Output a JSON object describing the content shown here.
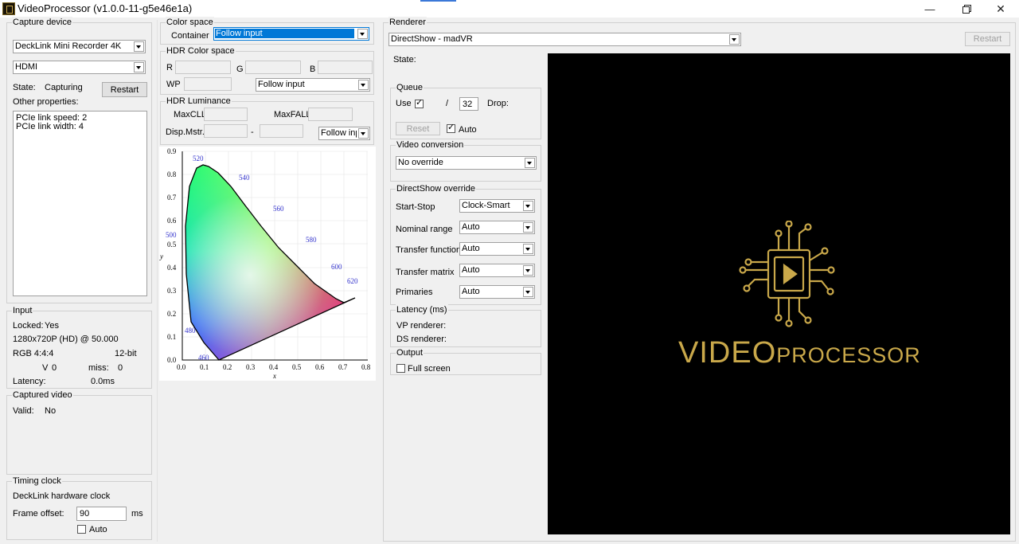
{
  "window": {
    "title": "VideoProcessor (v1.0.0-11-g5e46e1a)"
  },
  "capture_device": {
    "title": "Capture device",
    "device": "DeckLink Mini Recorder 4K",
    "input": "HDMI",
    "state_label": "State:",
    "state_value": "Capturing",
    "restart_label": "Restart",
    "other_properties_label": "Other properties:",
    "properties": [
      "PCIe link speed: 2",
      "PCIe link width: 4"
    ]
  },
  "input": {
    "title": "Input",
    "locked_label": "Locked:",
    "locked_value": "Yes",
    "mode": "1280x720P  (HD) @ 50.000",
    "format": "RGB 4:4:4",
    "bits": "12-bit",
    "v_label": "V",
    "v_value": "0",
    "miss_label": "miss:",
    "miss_value": "0",
    "latency_label": "Latency:",
    "latency_value": "0.0ms"
  },
  "captured_video": {
    "title": "Captured video",
    "valid_label": "Valid:",
    "valid_value": "No"
  },
  "timing_clock": {
    "title": "Timing clock",
    "source": "DeckLink hardware clock",
    "frame_offset_label": "Frame offset:",
    "frame_offset_value": "90",
    "unit": "ms",
    "auto_label": "Auto",
    "auto_checked": false
  },
  "color_space": {
    "title": "Color space",
    "container_label": "Container",
    "container_value": "Follow input"
  },
  "hdr_color_space": {
    "title": "HDR Color space",
    "r_label": "R",
    "g_label": "G",
    "b_label": "B",
    "wp_label": "WP",
    "mode": "Follow input"
  },
  "hdr_luminance": {
    "title": "HDR Luminance",
    "maxcll_label": "MaxCLL",
    "maxfall_label": "MaxFALL",
    "disp_mstr_label": "Disp.Mstr.",
    "dash": "-",
    "mode": "Follow inpu"
  },
  "cie_diagram": {
    "x_axis_label": "x",
    "y_axis_label": "y",
    "x_ticks": [
      "0.0",
      "0.1",
      "0.2",
      "0.3",
      "0.4",
      "0.5",
      "0.6",
      "0.7",
      "0.8"
    ],
    "y_ticks": [
      "0.0",
      "0.1",
      "0.2",
      "0.3",
      "0.4",
      "0.5",
      "0.6",
      "0.7",
      "0.8",
      "0.9"
    ],
    "wavelength_labels": [
      "460",
      "480",
      "500",
      "520",
      "540",
      "560",
      "580",
      "600",
      "620"
    ]
  },
  "renderer": {
    "title": "Renderer",
    "renderer_value": "DirectShow - madVR",
    "restart_label": "Restart",
    "state_label": "State:"
  },
  "queue": {
    "title": "Queue",
    "use_label": "Use",
    "use_checked": true,
    "slash": "/",
    "queue_size": "32",
    "drop_label": "Drop:",
    "reset_label": "Reset",
    "auto_label": "Auto",
    "auto_checked": true
  },
  "video_conversion": {
    "title": "Video conversion",
    "value": "No override"
  },
  "directshow_override": {
    "title": "DirectShow override",
    "rows": [
      {
        "label": "Start-Stop",
        "value": "Clock-Smart"
      },
      {
        "label": "Nominal range",
        "value": "Auto"
      },
      {
        "label": "Transfer function",
        "value": "Auto"
      },
      {
        "label": "Transfer matrix",
        "value": "Auto"
      },
      {
        "label": "Primaries",
        "value": "Auto"
      }
    ]
  },
  "latency": {
    "title": "Latency (ms)",
    "vp_label": "VP renderer:",
    "ds_label": "DS renderer:"
  },
  "output": {
    "title": "Output",
    "fullscreen_label": "Full screen",
    "fullscreen_checked": false
  },
  "logo": {
    "word_part1": "VIDEO",
    "word_part2": "PROCESSOR",
    "gold": "#c9a84a"
  },
  "colors": {
    "accent": "#0078d7",
    "viewport_bg": "#000000"
  }
}
